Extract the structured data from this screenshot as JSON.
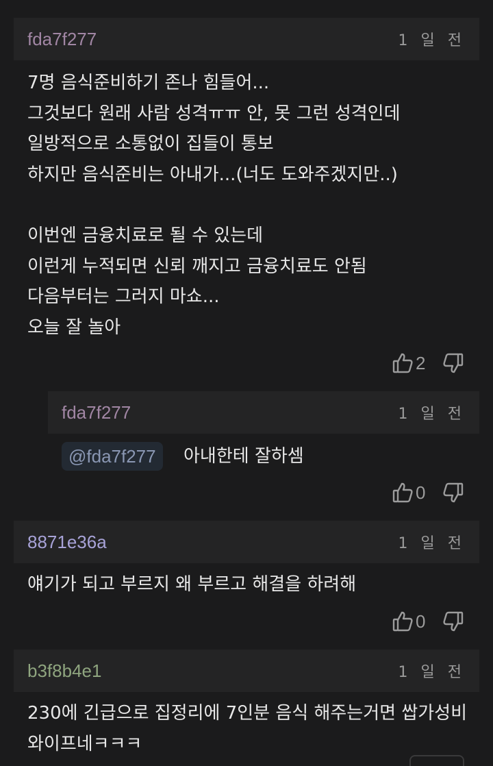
{
  "colors": {
    "background": "#1b1b1c",
    "header_bg": "#242425",
    "text": "#e8e8e8",
    "muted": "#9c9c9c",
    "user_fda7f277": "#a186a4",
    "user_8871e36a": "#a8a3d8",
    "user_b3f8b4e1": "#8fa57f"
  },
  "comments": [
    {
      "user": "fda7f277",
      "time": "1 일 전",
      "text": "7명 음식준비하기 존나 힘들어...\n그것보다 원래 사람 성격ㅠㅠ 안, 못 그런 성격인데\n일방적으로 소통없이 집들이 통보\n하지만 음식준비는 아내가...(너도 도와주겠지만..)\n\n이번엔 금융치료로 될 수 있는데\n이런게 누적되면 신뢰 깨지고 금융치료도 안됨\n다음부터는 그러지 마쇼...\n오늘 잘 놀아",
      "likes": "2",
      "like_icon": "thumbs-up-icon",
      "dislike_icon": "thumbs-down-icon"
    },
    {
      "user": "fda7f277",
      "time": "1 일 전",
      "mention": "@fda7f277",
      "text": "아내한테 잘하셈",
      "likes": "0"
    },
    {
      "user": "8871e36a",
      "time": "1 일 전",
      "text": "얘기가 되고 부르지 왜 부르고 해결을 하려해",
      "likes": "0"
    },
    {
      "user": "b3f8b4e1",
      "time": "1 일 전",
      "text": "230에 긴급으로 집정리에 7인분 음식 해주는거면 쌉가성비\n와이프네ㅋㅋㅋ"
    }
  ]
}
